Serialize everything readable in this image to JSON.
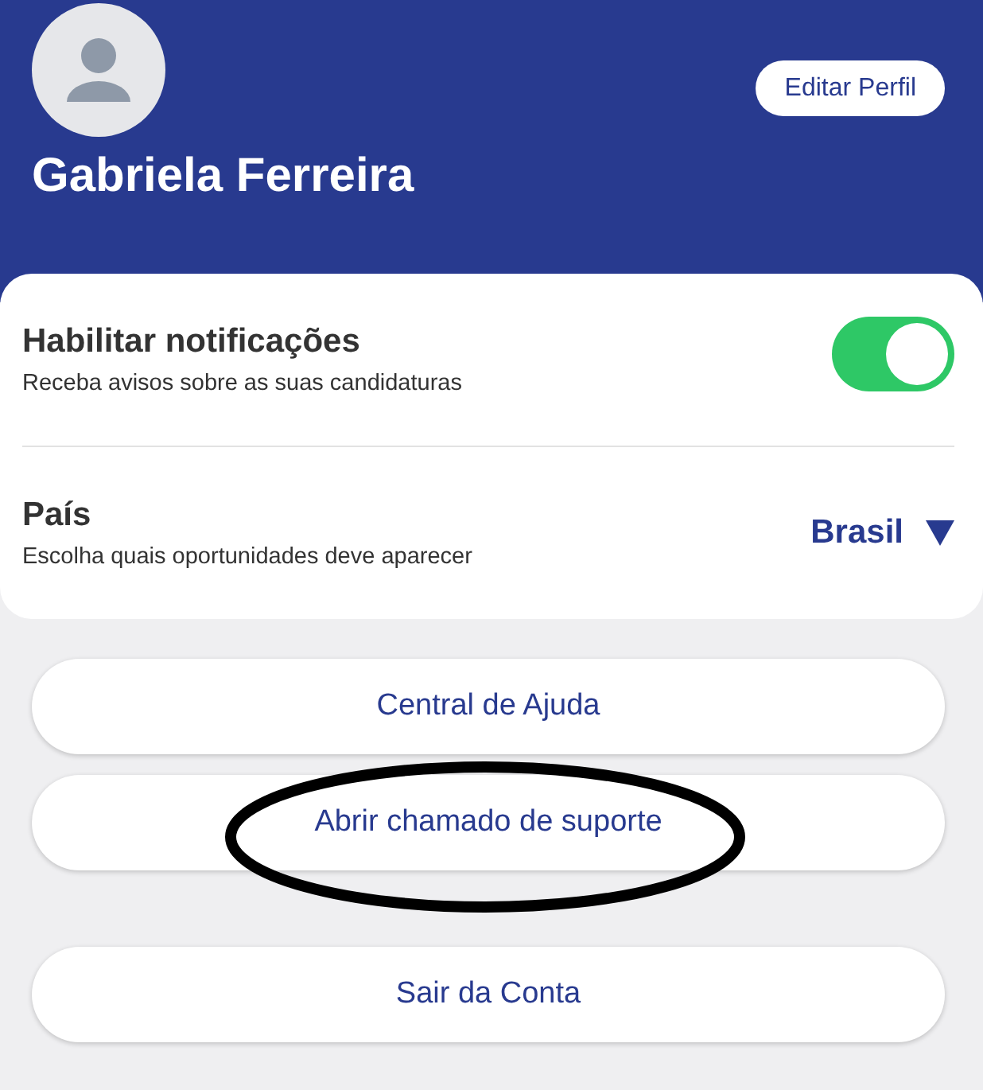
{
  "profile": {
    "name": "Gabriela Ferreira",
    "edit_button": "Editar Perfil"
  },
  "settings": [
    {
      "kind": "toggle",
      "title": "Habilitar notificações",
      "subtitle": "Receba avisos sobre as suas candidaturas",
      "on": true
    },
    {
      "kind": "select",
      "title": "País",
      "subtitle": "Escolha quais oportunidades deve aparecer",
      "value": "Brasil"
    }
  ],
  "buttons": [
    {
      "label": "Central de Ajuda",
      "circled": false
    },
    {
      "label": "Abrir chamado de suporte",
      "circled": true
    },
    {
      "label": "Sair da Conta",
      "circled": false
    }
  ]
}
